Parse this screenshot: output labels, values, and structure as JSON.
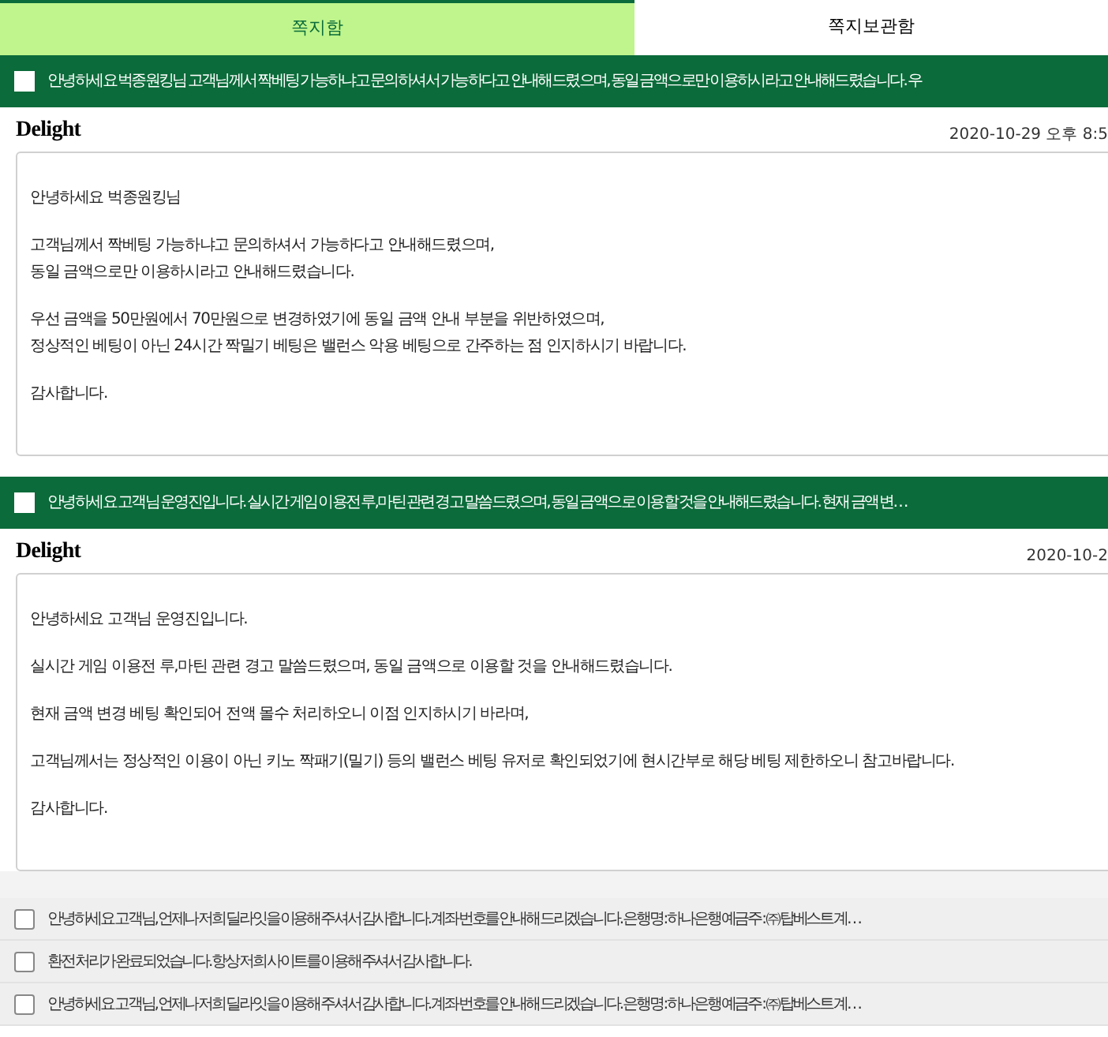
{
  "tabs": [
    {
      "label": "쪽지함",
      "selected": true
    },
    {
      "label": "쪽지보관함",
      "selected": false
    }
  ],
  "messages": [
    {
      "kind": "expanded",
      "checked": false,
      "subject": "안녕하세요 벅종원킹님 고객님께서 짝베팅 가능하냐고 문의하셔서 가능하다고 안내해드렸으며, 동일 금액으로만 이용하시라고 안내해드렸습니다. 우",
      "logo": "Delight",
      "date": "2020-10-29 오후 8:5",
      "paragraphs": [
        [
          "안녕하세요 벅종원킹님"
        ],
        [
          "고객님께서 짝베팅 가능하냐고 문의하셔서 가능하다고 안내해드렸으며,",
          "동일 금액으로만 이용하시라고 안내해드렸습니다."
        ],
        [
          "우선 금액을 50만원에서 70만원으로 변경하였기에 동일 금액 안내 부분을 위반하였으며,",
          "정상적인 베팅이 아닌 24시간 짝밀기 베팅은 밸런스 악용 베팅으로 간주하는 점 인지하시기 바랍니다."
        ],
        [
          "감사합니다."
        ]
      ]
    },
    {
      "kind": "expanded",
      "checked": false,
      "subject": "안녕하세요 고객님 운영진입니다. 실시간 게임 이용전 루,마틴 관련 경고 말씀드렸으며, 동일 금액으로 이용할 것을 안내해드렸습니다. 현재 금액 변…",
      "logo": "Delight",
      "date": "2020-10-2",
      "paragraphs": [
        [
          "안녕하세요 고객님 운영진입니다."
        ],
        [
          "실시간 게임 이용전 루,마틴 관련 경고 말씀드렸으며, 동일 금액으로 이용할 것을 안내해드렸습니다."
        ],
        [
          "현재 금액 변경 베팅 확인되어 전액 몰수 처리하오니 이점 인지하시기 바라며,"
        ],
        [
          "고객님께서는 정상적인 이용이 아닌 키노 짝패기(밀기) 등의 밸런스 베팅 유저로 확인되었기에 현시간부로 해당 베팅 제한하오니 참고바랍니다."
        ],
        [
          "감사합니다."
        ]
      ]
    },
    {
      "kind": "collapsed",
      "checked": false,
      "subject": "안녕하세요 고객님, 언제나 저희 딜라잇을 이용해 주셔서 감사합니다. 계좌 번호를 안내해 드리겠습니다. 은행명 : 하나은행 예금주 : ㈜ 탑베스트 계…"
    },
    {
      "kind": "collapsed",
      "checked": false,
      "subject": "환전 처리가 완료되었습니다. 항상 저희 사이트를 이용해 주셔서 감사합니다."
    },
    {
      "kind": "collapsed",
      "checked": false,
      "subject": "안녕하세요 고객님, 언제나 저희 딜라잇을 이용해 주셔서 감사합니다. 계좌 번호를 안내해 드리겠습니다. 은행명 : 하나은행 예금주 : ㈜ 탑베스트 계…"
    }
  ]
}
